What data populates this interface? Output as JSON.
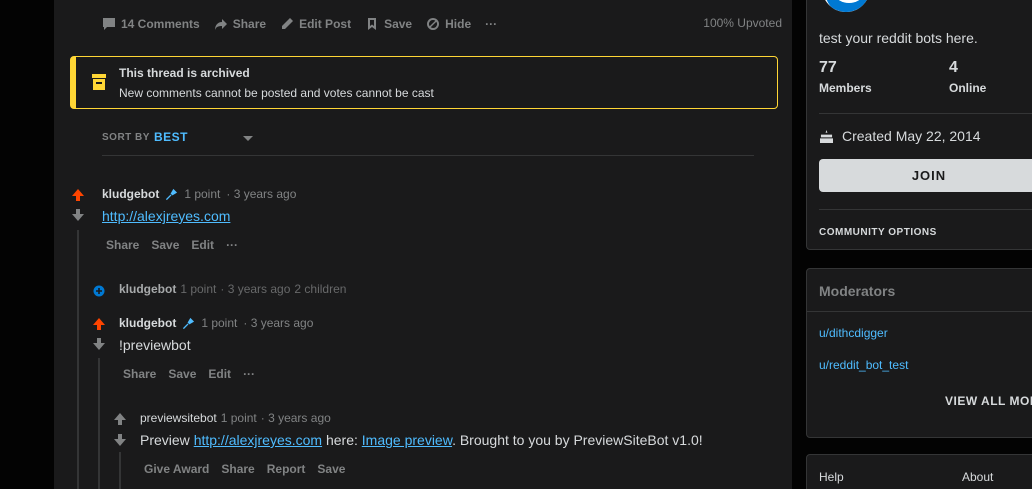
{
  "post_actions": {
    "comments": "14 Comments",
    "share": "Share",
    "edit_post": "Edit Post",
    "save": "Save",
    "hide": "Hide",
    "more": "···",
    "upvoted": "100% Upvoted"
  },
  "archived": {
    "title": "This thread is archived",
    "message": "New comments cannot be posted and votes cannot be cast"
  },
  "sort": {
    "label": "SORT BY",
    "value": "BEST"
  },
  "comments": [
    {
      "author": "kludgebot",
      "points": "1 point",
      "age": "· 3 years ago",
      "body_link": "http://alexjreyes.com",
      "actions": [
        "Share",
        "Save",
        "Edit",
        "···"
      ]
    },
    {
      "author": "kludgebot",
      "points": "1 point",
      "age": "· 3 years ago",
      "children": "2 children"
    },
    {
      "author": "kludgebot",
      "points": "1 point",
      "age": "· 3 years ago",
      "body": "!previewbot",
      "actions": [
        "Share",
        "Save",
        "Edit",
        "···"
      ]
    },
    {
      "author": "previewsitebot",
      "points": "1 point",
      "age": "· 3 years ago",
      "body_pre": "Preview ",
      "body_link1": "http://alexjreyes.com",
      "body_mid": " here: ",
      "body_link2": "Image preview",
      "body_post": ". Brought to you by PreviewSiteBot v1.0!",
      "actions": [
        "Give Award",
        "Share",
        "Report",
        "Save"
      ]
    }
  ],
  "sidebar": {
    "description": "test your reddit bots here.",
    "members_count": "77",
    "members_label": "Members",
    "online_count": "4",
    "online_label": "Online",
    "created": "Created May 22, 2014",
    "join": "JOIN",
    "community_options": "COMMUNITY OPTIONS",
    "moderators_title": "Moderators",
    "moderators": [
      "u/dithcdigger",
      "u/reddit_bot_test"
    ],
    "view_all": "VIEW ALL MOD",
    "footer_help": "Help",
    "footer_about": "About"
  },
  "colors": {
    "upvote": "#ff4500",
    "archived_border": "#ffd635",
    "link": "#4fbcff"
  }
}
